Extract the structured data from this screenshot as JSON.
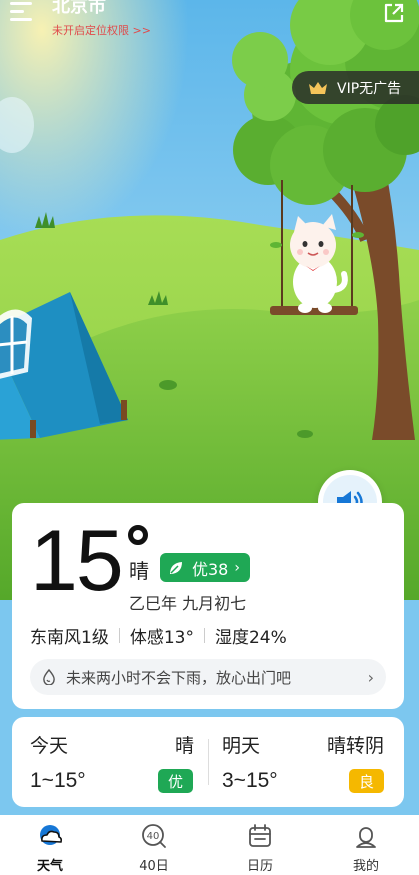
{
  "header": {
    "city": "北京市",
    "location_warning": "未开启定位权限 >>"
  },
  "vip": {
    "label": "VIP无广告"
  },
  "current": {
    "temperature": "15",
    "condition": "晴",
    "aqi_label": "优38",
    "lunar_date": "乙巳年 九月初七",
    "wind": "东南风1级",
    "feels_like": "体感13°",
    "humidity": "湿度24%",
    "rain_tip": "未来两小时不会下雨，放心出门吧"
  },
  "forecast": [
    {
      "day": "今天",
      "condition": "晴",
      "range": "1~15°",
      "aqi": "优",
      "aqi_color": "#1fa855"
    },
    {
      "day": "明天",
      "condition": "晴转阴",
      "range": "3~15°",
      "aqi": "良",
      "aqi_color": "#f5b800"
    }
  ],
  "nav": [
    {
      "label": "天气",
      "icon": "cloud-weather-icon",
      "active": true
    },
    {
      "label": "40日",
      "icon": "forty-day-icon",
      "active": false
    },
    {
      "label": "日历",
      "icon": "calendar-icon",
      "active": false
    },
    {
      "label": "我的",
      "icon": "profile-icon",
      "active": false
    }
  ],
  "colors": {
    "accent_green": "#1fa855",
    "warning_red": "#e04b4b",
    "good_yellow": "#f5b800",
    "sky": "#7cc7ef"
  }
}
